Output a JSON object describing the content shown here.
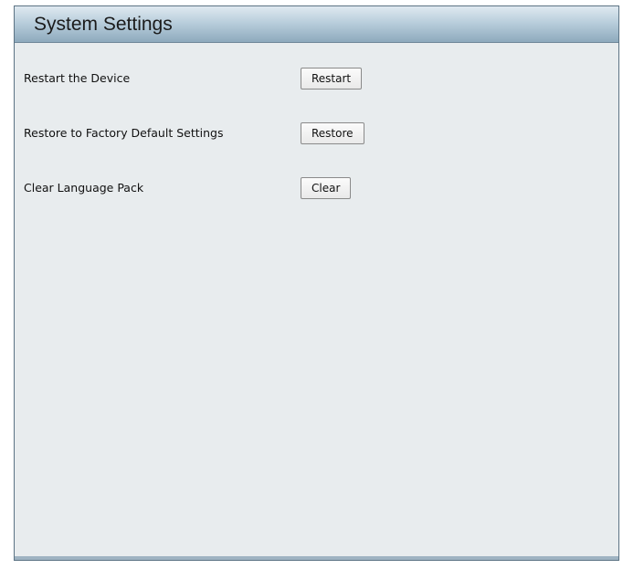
{
  "panel": {
    "title": "System Settings"
  },
  "rows": [
    {
      "label": "Restart the Device",
      "button": "Restart"
    },
    {
      "label": "Restore to Factory Default Settings",
      "button": "Restore"
    },
    {
      "label": "Clear Language Pack",
      "button": "Clear"
    }
  ]
}
